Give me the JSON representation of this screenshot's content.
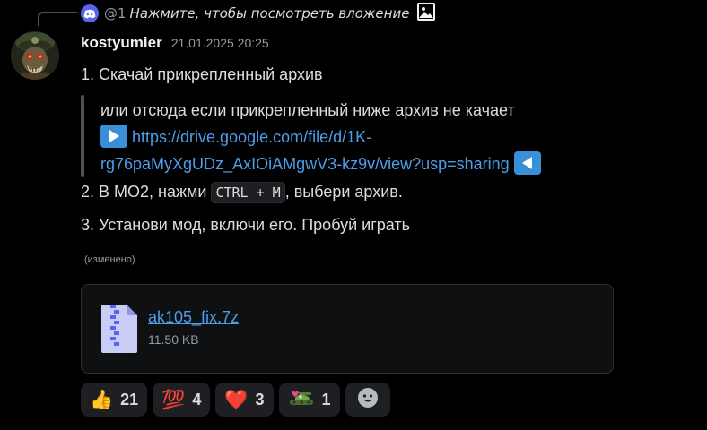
{
  "reply": {
    "mention": "@1",
    "hint": "Нажмите, чтобы посмотреть вложение"
  },
  "message": {
    "username": "kostyumier",
    "timestamp": "21.01.2025 20:25",
    "item1": "1. Скачай прикрепленный архив",
    "quote_text": "или отсюда если прикрепленный ниже архив не качает",
    "link_line1": "https://drive.google.com/file/d/1K-",
    "link_line2": "rg76paMyXgUDz_AxIOiAMgwV3-kz9v/view?usp=sharing",
    "item2_before": "2. В МО2, нажми ",
    "item2_code": "CTRL + M",
    "item2_after": ", выбери архив.",
    "item3": "3. Установи мод, включи его. Пробуй играть",
    "edited": "(изменено)"
  },
  "attachment": {
    "file_name": "ak105_fix.7z",
    "file_size": "11.50 KB"
  },
  "reactions": [
    {
      "emoji": "👍",
      "icon": "thumbs-up",
      "count": "21"
    },
    {
      "emoji": "💯",
      "icon": "hundred-points",
      "count": "4"
    },
    {
      "emoji": "❤️",
      "icon": "red-heart",
      "count": "3"
    },
    {
      "emoji": "🐸",
      "icon": "pepe-tank",
      "count": "1"
    }
  ],
  "colors": {
    "background": "#000000",
    "link": "#4d9eea",
    "muted": "#949ba4",
    "blurple": "#5865f2"
  }
}
